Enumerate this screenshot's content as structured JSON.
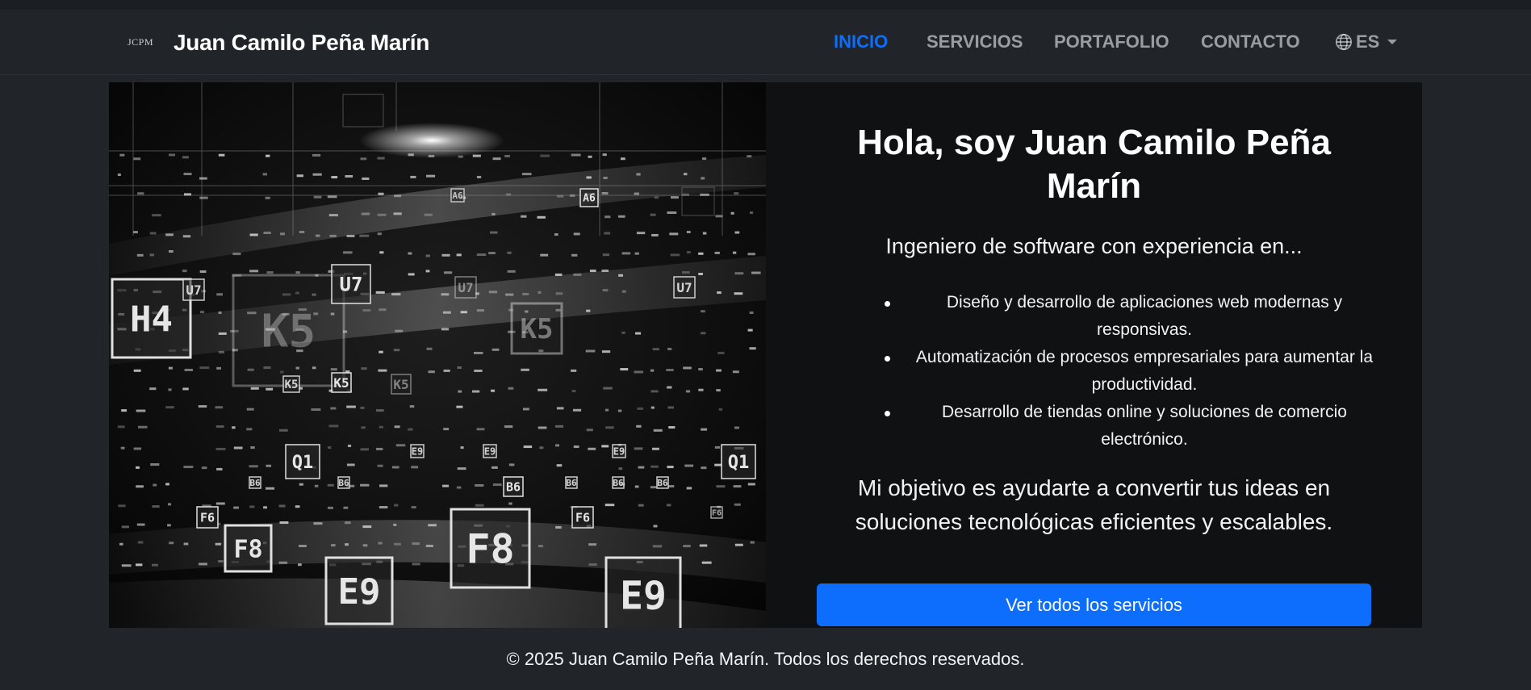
{
  "brand": {
    "logo_text": "JCPM",
    "name": "Juan Camilo Peña Marín"
  },
  "nav": {
    "items": [
      {
        "label": "INICIO",
        "active": true
      },
      {
        "label": "SERVICIOS",
        "active": false
      },
      {
        "label": "PORTAFOLIO",
        "active": false
      },
      {
        "label": "CONTACTO",
        "active": false
      }
    ],
    "language": {
      "label": "ES",
      "icon": "globe-icon"
    }
  },
  "hero": {
    "image_labels": [
      "H4",
      "K5",
      "U7",
      "Q1",
      "B6",
      "F6",
      "F8",
      "E9",
      "A6"
    ],
    "title": "Hola, soy Juan Camilo Peña Marín",
    "lead": "Ingeniero de software con experiencia en...",
    "bullets": [
      "Diseño y desarrollo de aplicaciones web modernas y responsivas.",
      "Automatización de procesos empresariales para aumentar la productividad.",
      "Desarrollo de tiendas online y soluciones de comercio electrónico."
    ],
    "goal": "Mi objetivo es ayudarte a convertir tus ideas en soluciones tecnológicas eficientes y escalables.",
    "button_label": "Ver todos los servicios"
  },
  "footer": {
    "text": "© 2025 Juan Camilo Peña Marín. Todos los derechos reservados."
  },
  "colors": {
    "accent": "#0d6efd",
    "nav_bg": "#212529",
    "content_bg": "#0f1113"
  }
}
